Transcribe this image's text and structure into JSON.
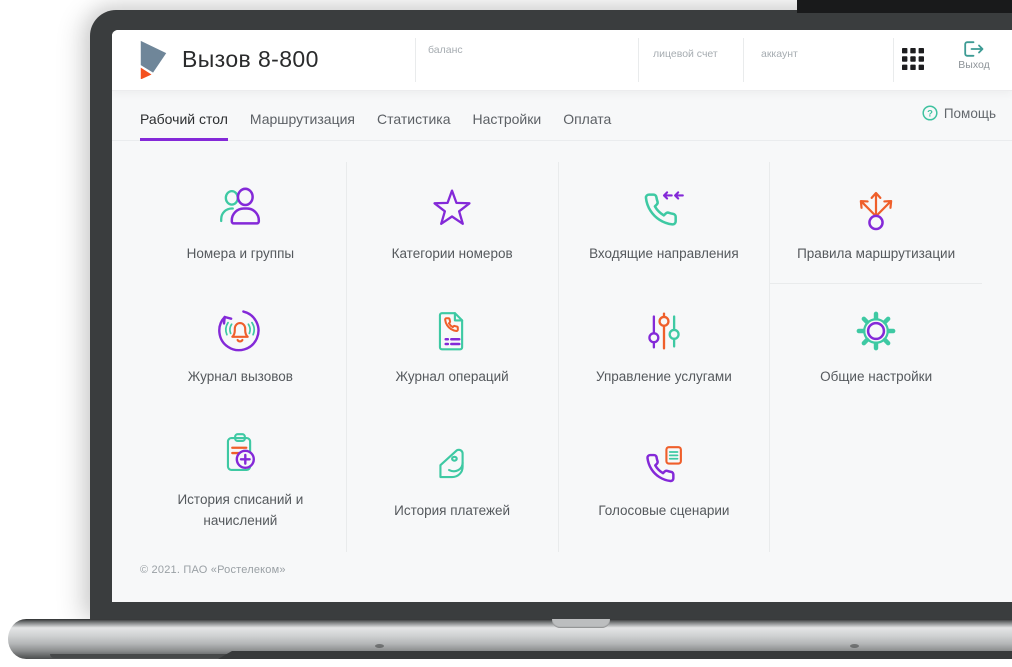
{
  "header": {
    "title": "Вызов 8-800",
    "balance_label": "баланс",
    "personal_account_label": "лицевой счет",
    "account_label": "аккаунт",
    "logout_label": "Выход"
  },
  "tabs": {
    "items": [
      {
        "label": "Рабочий стол",
        "active": true
      },
      {
        "label": "Маршрутизация",
        "active": false
      },
      {
        "label": "Статистика",
        "active": false
      },
      {
        "label": "Настройки",
        "active": false
      },
      {
        "label": "Оплата",
        "active": false
      }
    ],
    "help_label": "Помощь"
  },
  "tiles": [
    {
      "label": "Номера и группы",
      "icon": "users-icon"
    },
    {
      "label": "Категории номеров",
      "icon": "star-icon"
    },
    {
      "label": "Входящие направления",
      "icon": "incoming-call-icon"
    },
    {
      "label": "Правила маршрутизации",
      "icon": "routing-rules-icon"
    },
    {
      "label": "Журнал вызовов",
      "icon": "call-log-icon"
    },
    {
      "label": "Журнал операций",
      "icon": "operations-log-icon"
    },
    {
      "label": "Управление услугами",
      "icon": "sliders-icon"
    },
    {
      "label": "Общие настройки",
      "icon": "gear-icon"
    },
    {
      "label": "История списаний и начислений",
      "icon": "clipboard-plus-icon"
    },
    {
      "label": "История платежей",
      "icon": "wallet-icon"
    },
    {
      "label": "Голосовые сценарии",
      "icon": "voice-script-icon"
    }
  ],
  "footer": {
    "copyright": "© 2021. ПАО «Ростелеком»"
  },
  "colors": {
    "purple": "#8429d8",
    "teal": "#3ec9a3",
    "orange": "#ef5f2b",
    "logo_blue": "#6f8699",
    "logo_orange": "#f4501e"
  }
}
